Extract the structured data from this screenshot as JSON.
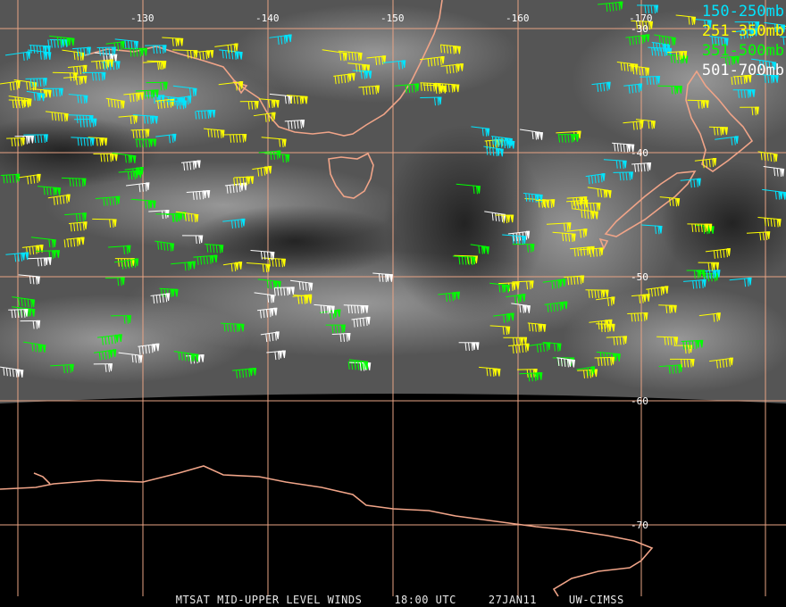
{
  "map": {
    "longitude_labels": [
      "-130",
      "-140",
      "-150",
      "-160",
      "-170"
    ],
    "latitude_labels": [
      "-30",
      "-40",
      "-50",
      "-60",
      "-70"
    ],
    "colors": {
      "grid": "#e8a384",
      "coast": "#f0a488",
      "space": "#000000",
      "wv_dark": "#3b3b3b",
      "wv_light": "#9a9a9a"
    }
  },
  "legend": [
    {
      "label": "150-250mb",
      "color": "#00e5ff"
    },
    {
      "label": "251-350mb",
      "color": "#ffff00"
    },
    {
      "label": "351-500mb",
      "color": "#00ff00"
    },
    {
      "label": "501-700mb",
      "color": "#ffffff"
    }
  ],
  "caption": {
    "product": "MTSAT MID-UPPER LEVEL WINDS",
    "time": "18:00 UTC",
    "date": "27JAN11",
    "source": "UW-CIMSS"
  }
}
